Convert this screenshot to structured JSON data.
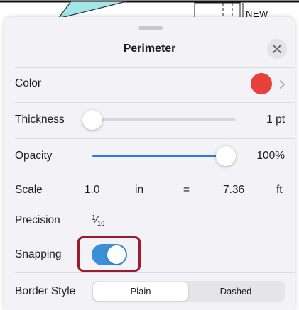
{
  "background_drawing": {
    "label": "NEW"
  },
  "sheet": {
    "title": "Perimeter",
    "close_icon": "close-icon",
    "color": {
      "label": "Color",
      "value": "#e8403a"
    },
    "thickness": {
      "label": "Thickness",
      "value_text": "1 pt",
      "level": 0.0
    },
    "opacity": {
      "label": "Opacity",
      "value_text": "100%",
      "level": 1.0
    },
    "scale": {
      "label": "Scale",
      "left_value": "1.0",
      "left_unit": "in",
      "equals": "=",
      "right_value": "7.36",
      "right_unit": "ft"
    },
    "precision": {
      "label": "Precision",
      "num": "1",
      "den": "16"
    },
    "snapping": {
      "label": "Snapping",
      "on": true
    },
    "border_style": {
      "label": "Border Style",
      "options": [
        "Plain",
        "Dashed"
      ],
      "selected": "Plain"
    },
    "colors": {
      "accent": "#2c7be5",
      "toggle_on": "#3a8fd6",
      "highlight": "#9b1b30"
    }
  }
}
